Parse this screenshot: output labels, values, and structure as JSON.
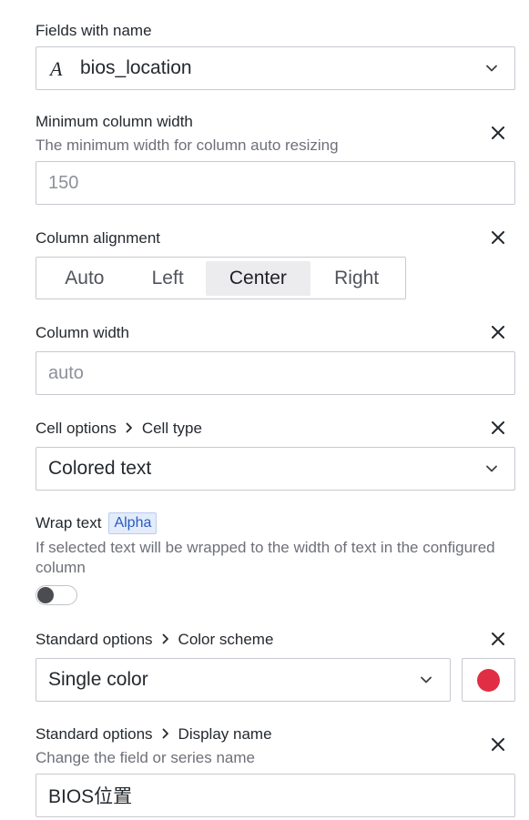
{
  "fields_with_name": {
    "label": "Fields with name",
    "value": "bios_location",
    "type_icon": "field-type-string-icon"
  },
  "min_col_width": {
    "label": "Minimum column width",
    "description": "The minimum width for column auto resizing",
    "placeholder": "150"
  },
  "column_alignment": {
    "label": "Column alignment",
    "options": [
      "Auto",
      "Left",
      "Center",
      "Right"
    ],
    "selected": "Center"
  },
  "column_width": {
    "label": "Column width",
    "placeholder": "auto"
  },
  "cell_type": {
    "crumb1": "Cell options",
    "crumb2": "Cell type",
    "value": "Colored text"
  },
  "wrap_text": {
    "label": "Wrap text",
    "badge": "Alpha",
    "description": "If selected text will be wrapped to the width of text in the configured column",
    "enabled": false
  },
  "color_scheme": {
    "crumb1": "Standard options",
    "crumb2": "Color scheme",
    "value": "Single color",
    "swatch_color": "#e02f44"
  },
  "display_name": {
    "crumb1": "Standard options",
    "crumb2": "Display name",
    "description": "Change the field or series name",
    "value": "BIOS位置"
  }
}
